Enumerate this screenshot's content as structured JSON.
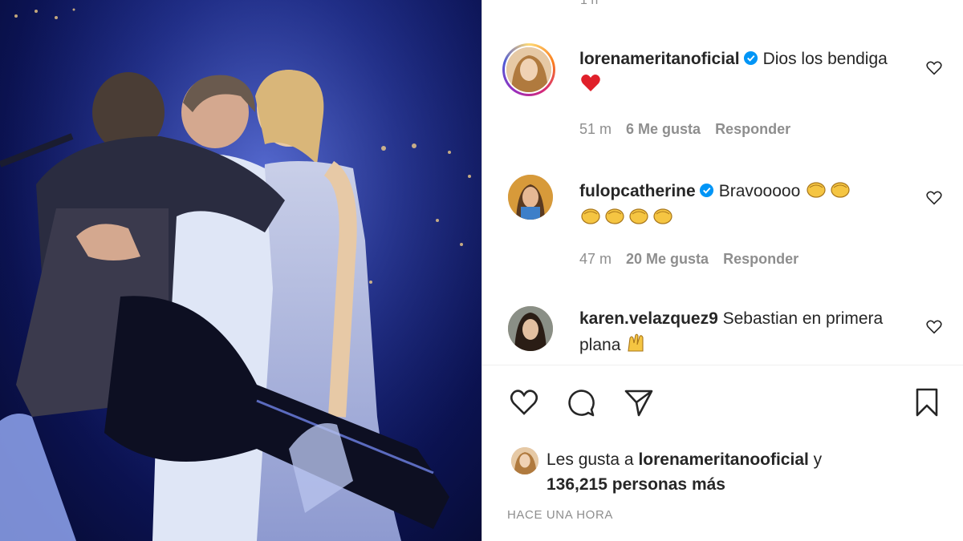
{
  "post_image": {
    "alt_icon": "concert-photo"
  },
  "comments": [
    {
      "username": "lorenameritanoficial",
      "verified": true,
      "text": "Dios los bendiga",
      "emoji": "red-heart",
      "time": "51 m",
      "likes": "6 Me gusta",
      "reply": "Responder"
    },
    {
      "username": "fulopcatherine",
      "verified": true,
      "text": "Bravooooo",
      "emoji": "clapping-hands",
      "time": "47 m",
      "likes": "20 Me gusta",
      "reply": "Responder"
    },
    {
      "username": "karen.velazquez9",
      "verified": false,
      "text": "Sebastian en primera plana",
      "emoji": "raising-hands"
    }
  ],
  "likes_summary": {
    "prefix": "Les gusta a",
    "user": "lorenameritanooficial",
    "connector": "y",
    "others": "136,215 personas más"
  },
  "timestamp": "HACE UNA HORA",
  "colors": {
    "text": "#262626",
    "muted": "#8e8e8e",
    "verified": "#0095f6",
    "heart": "#ed4956"
  }
}
